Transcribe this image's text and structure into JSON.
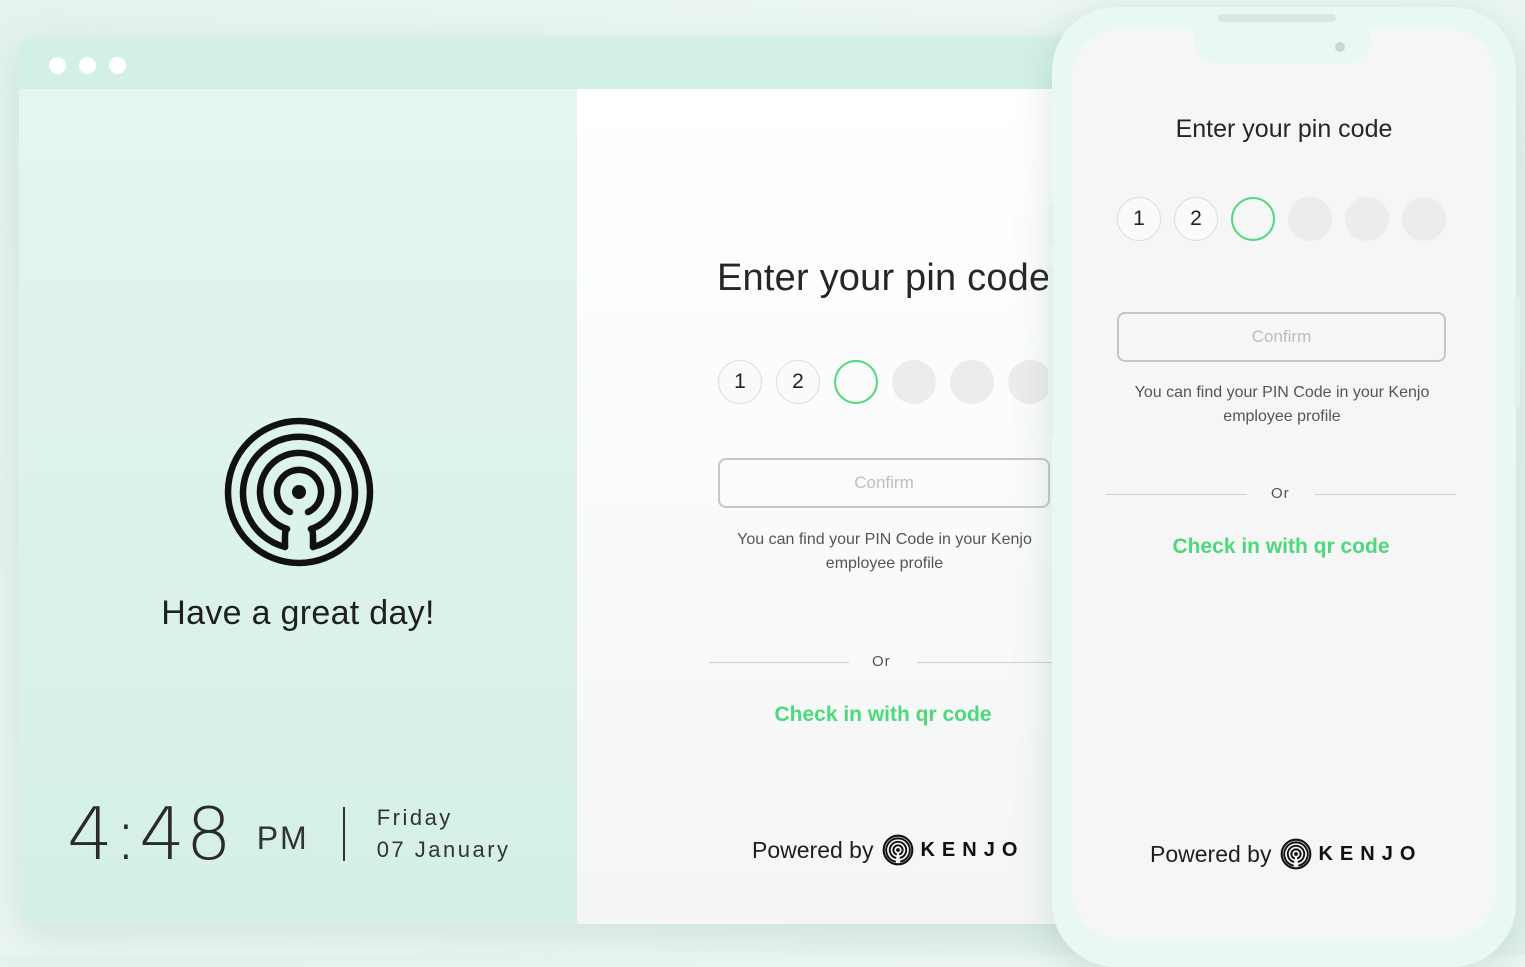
{
  "colors": {
    "accent_green": "#4cd87b",
    "titlebar": "#d3f0e5",
    "left_panel": "#e0f4ee"
  },
  "window": {
    "controls": [
      "window-dot",
      "window-dot",
      "window-dot"
    ]
  },
  "kiosk": {
    "greeting": "Have a great day!",
    "time": "4:48",
    "ampm": "PM",
    "weekday": "Friday",
    "date": "07 January"
  },
  "pin_screen": {
    "title": "Enter your pin code",
    "digits": [
      "1",
      "2",
      "",
      "",
      "",
      ""
    ],
    "confirm_label": "Confirm",
    "helper_text": "You can find your PIN Code in your Kenjo employee profile",
    "or_label": "Or",
    "qr_link": "Check in with qr code",
    "powered_by": "Powered by",
    "brand": "KENJO"
  },
  "mobile": {
    "title": "Enter your pin code",
    "digits": [
      "1",
      "2",
      "",
      "",
      "",
      ""
    ],
    "confirm_label": "Confirm",
    "helper_text": "You can find your PIN Code in your Kenjo employee profile",
    "or_label": "Or",
    "qr_link": "Check in with qr code",
    "powered_by": "Powered by",
    "brand": "KENJO"
  }
}
